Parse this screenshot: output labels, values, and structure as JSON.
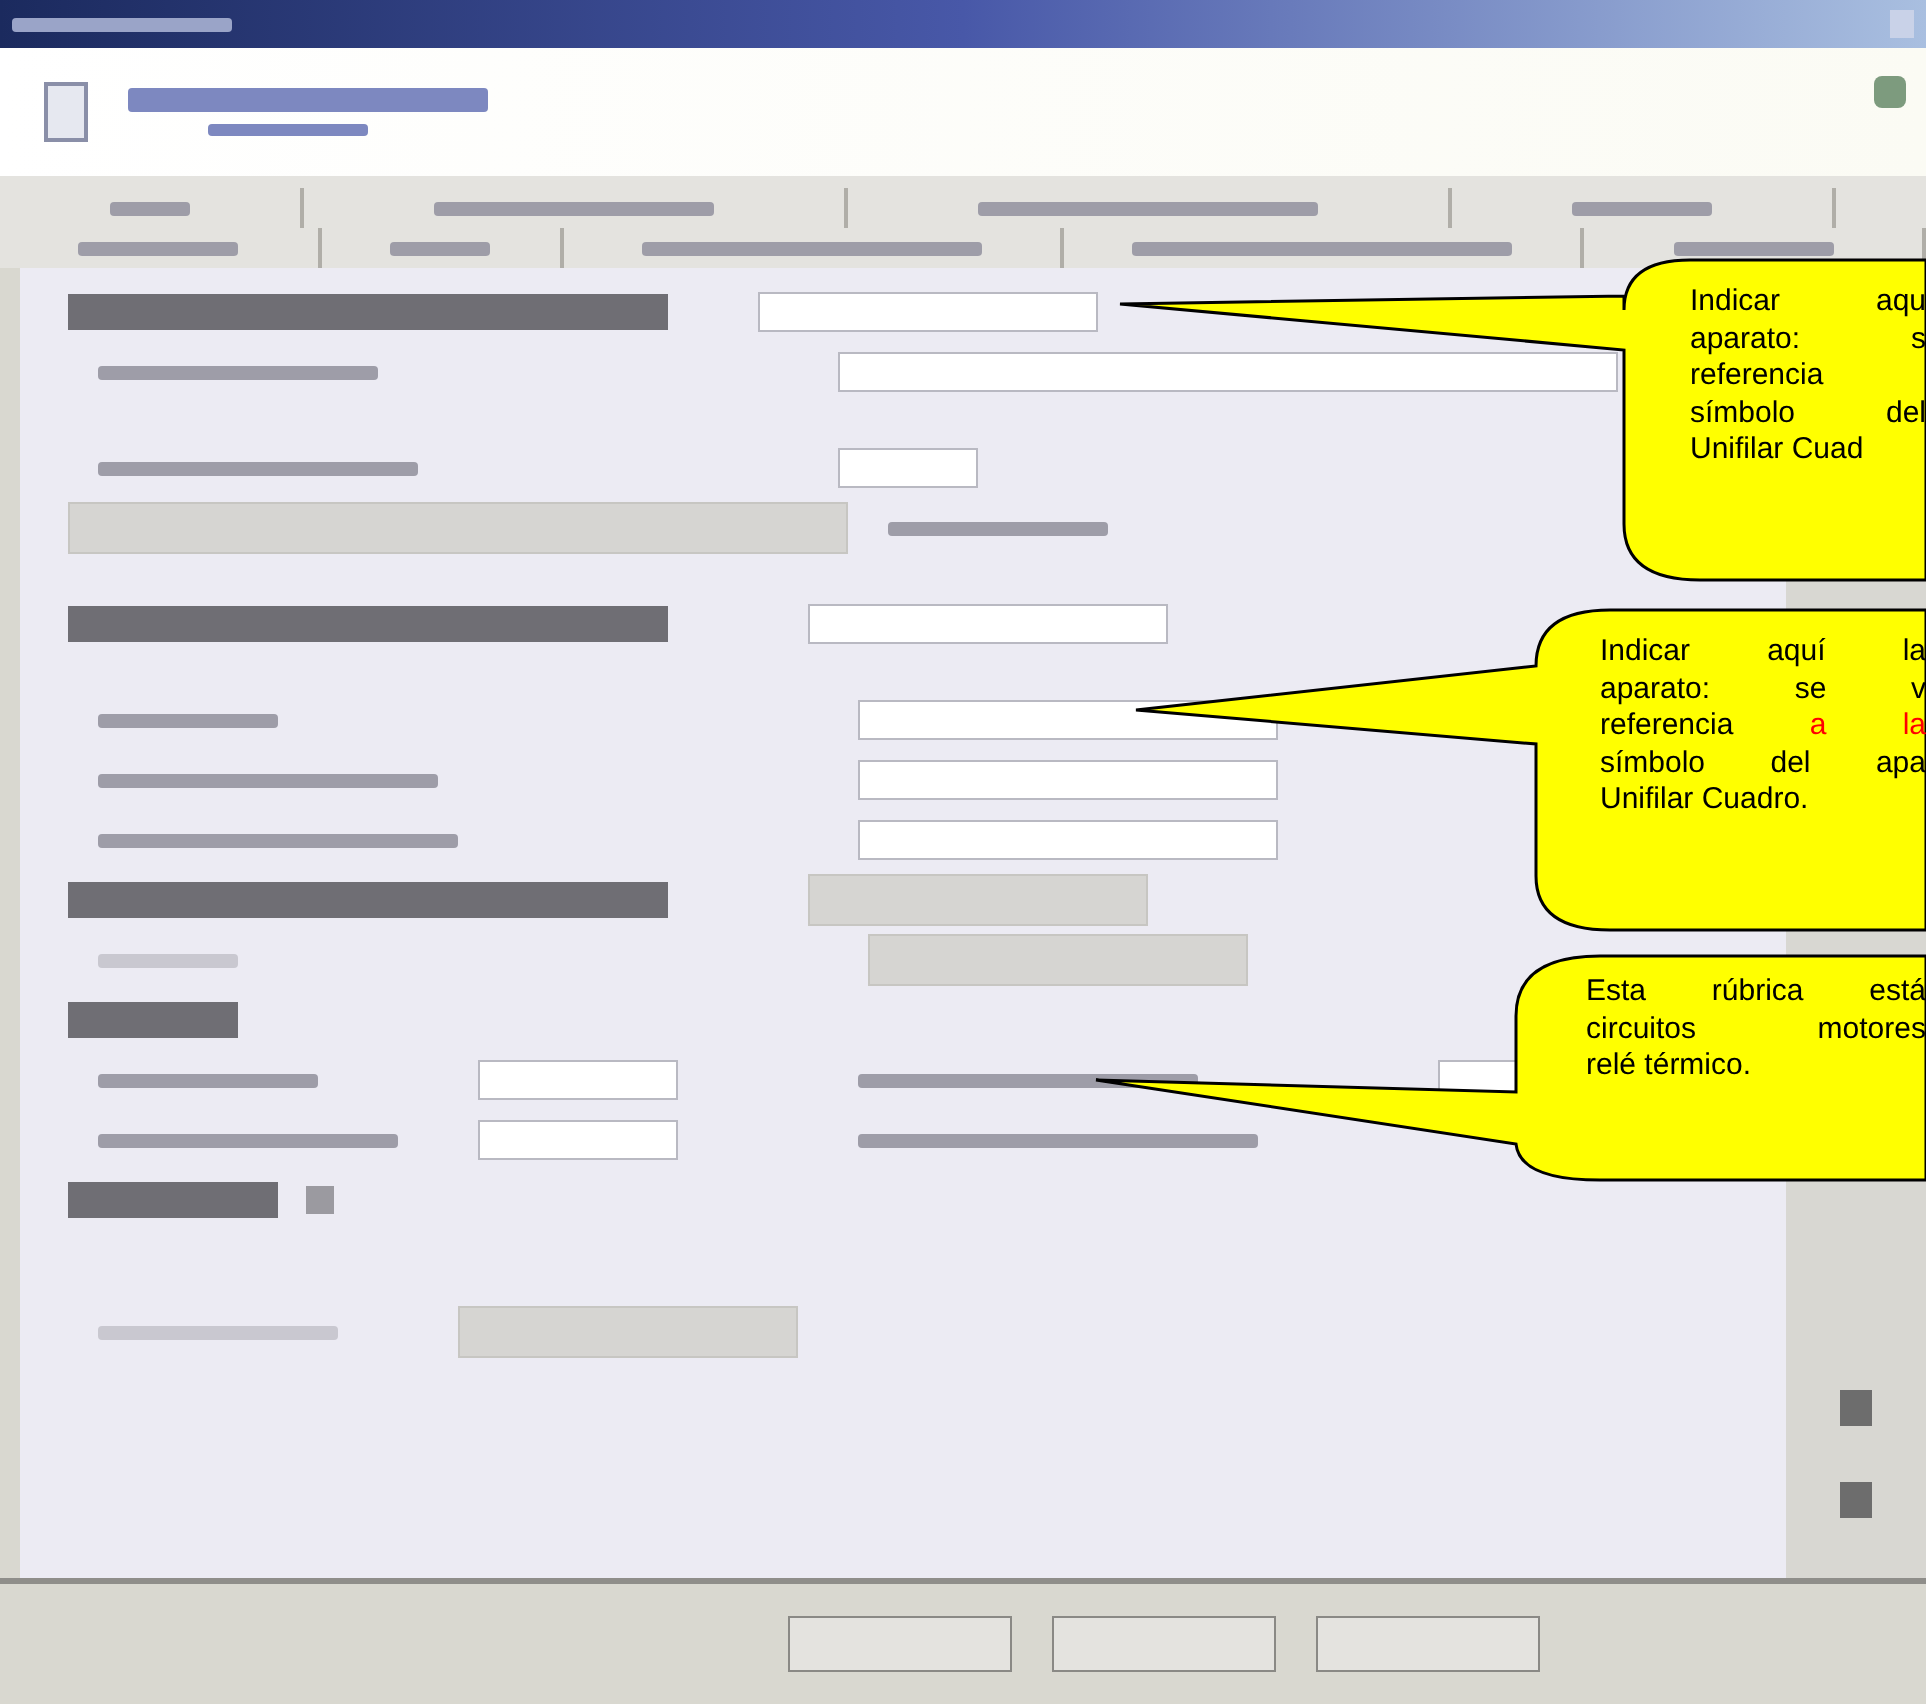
{
  "callouts": [
    {
      "lines": [
        [
          {
            "text": "Indicar aqu",
            "highlight": false
          }
        ],
        [
          {
            "text": "aparato: s",
            "highlight": false
          }
        ],
        [
          {
            "text": "referencia",
            "highlight": false
          }
        ],
        [
          {
            "text": "símbolo del",
            "highlight": false
          }
        ],
        [
          {
            "text": "Unifilar Cuad",
            "highlight": false
          }
        ]
      ]
    },
    {
      "lines": [
        [
          {
            "text": "Indicar aquí la",
            "highlight": false
          }
        ],
        [
          {
            "text": "aparato: se v",
            "highlight": false
          }
        ],
        [
          {
            "text": "referencia ",
            "highlight": false
          },
          {
            "text": "a la",
            "highlight": true
          }
        ],
        [
          {
            "text": "símbolo del apa",
            "highlight": false
          }
        ],
        [
          {
            "text": "Unifilar Cuadro.",
            "highlight": false
          }
        ]
      ]
    },
    {
      "lines": [
        [
          {
            "text": "Esta rúbrica está",
            "highlight": false
          }
        ],
        [
          {
            "text": "circuitos motores",
            "highlight": false
          }
        ],
        [
          {
            "text": "relé térmico.",
            "highlight": false
          }
        ]
      ]
    }
  ]
}
